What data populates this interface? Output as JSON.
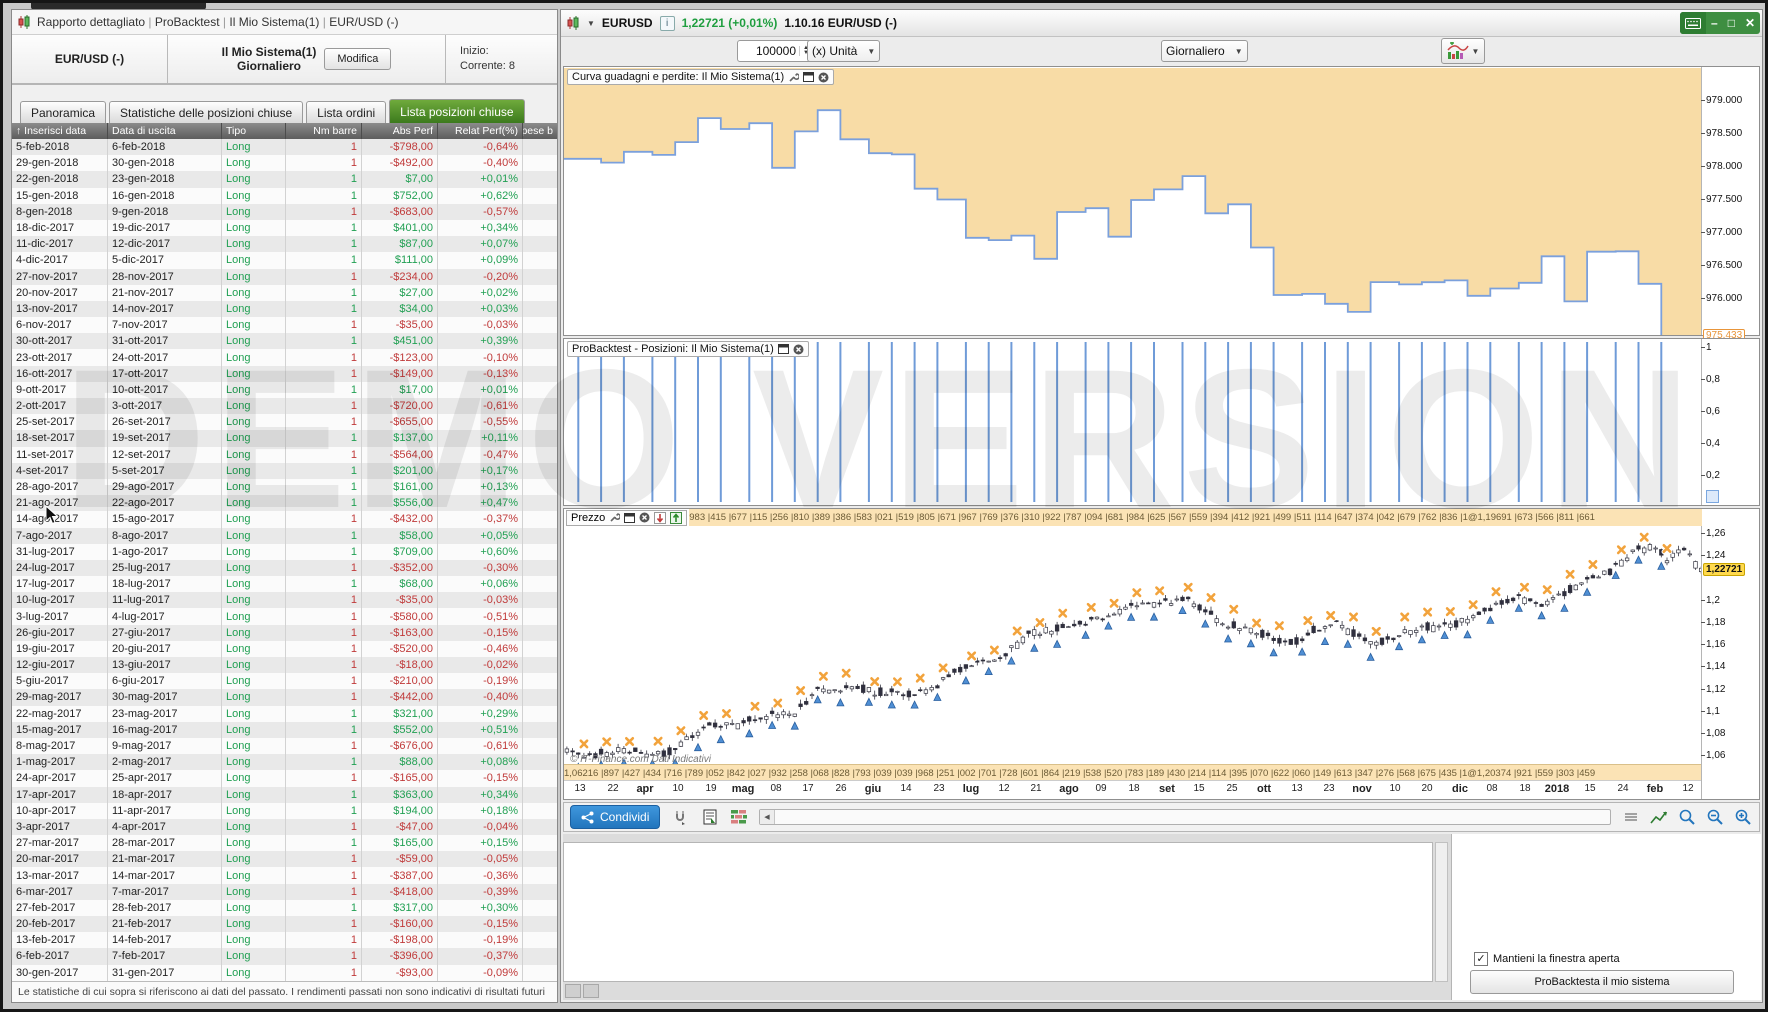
{
  "watermark": "DEMO VERSION",
  "report_window": {
    "breadcrumb": [
      "Rapporto dettagliato",
      "ProBacktest",
      "Il Mio Sistema(1)",
      "EUR/USD (-)"
    ],
    "header": {
      "instrument": "EUR/USD (-)",
      "system": "Il Mio Sistema(1)",
      "timeframe": "Giornaliero",
      "modify": "Modifica",
      "start_label": "Inizio:",
      "current_label": "Corrente: 8"
    },
    "tabs": [
      {
        "label": "Panoramica",
        "active": false
      },
      {
        "label": "Statistiche delle posizioni chiuse",
        "active": false
      },
      {
        "label": "Lista ordini",
        "active": false
      },
      {
        "label": "Lista posizioni chiuse",
        "active": true
      }
    ],
    "table": {
      "sort_icon": "↑",
      "columns": [
        "Inserisci data",
        "Data di uscita",
        "Tipo",
        "Nm barre",
        "Abs Perf",
        "Relat Perf(%)",
        "Spese b"
      ],
      "rows": [
        [
          "5-feb-2018",
          "6-feb-2018",
          "Long",
          "1",
          "-$798,00",
          "-0,64%"
        ],
        [
          "29-gen-2018",
          "30-gen-2018",
          "Long",
          "1",
          "-$492,00",
          "-0,40%"
        ],
        [
          "22-gen-2018",
          "23-gen-2018",
          "Long",
          "1",
          "$7,00",
          "+0,01%"
        ],
        [
          "15-gen-2018",
          "16-gen-2018",
          "Long",
          "1",
          "$752,00",
          "+0,62%"
        ],
        [
          "8-gen-2018",
          "9-gen-2018",
          "Long",
          "1",
          "-$683,00",
          "-0,57%"
        ],
        [
          "18-dic-2017",
          "19-dic-2017",
          "Long",
          "1",
          "$401,00",
          "+0,34%"
        ],
        [
          "11-dic-2017",
          "12-dic-2017",
          "Long",
          "1",
          "$87,00",
          "+0,07%"
        ],
        [
          "4-dic-2017",
          "5-dic-2017",
          "Long",
          "1",
          "$111,00",
          "+0,09%"
        ],
        [
          "27-nov-2017",
          "28-nov-2017",
          "Long",
          "1",
          "-$234,00",
          "-0,20%"
        ],
        [
          "20-nov-2017",
          "21-nov-2017",
          "Long",
          "1",
          "$27,00",
          "+0,02%"
        ],
        [
          "13-nov-2017",
          "14-nov-2017",
          "Long",
          "1",
          "$34,00",
          "+0,03%"
        ],
        [
          "6-nov-2017",
          "7-nov-2017",
          "Long",
          "1",
          "-$35,00",
          "-0,03%"
        ],
        [
          "30-ott-2017",
          "31-ott-2017",
          "Long",
          "1",
          "$451,00",
          "+0,39%"
        ],
        [
          "23-ott-2017",
          "24-ott-2017",
          "Long",
          "1",
          "-$123,00",
          "-0,10%"
        ],
        [
          "16-ott-2017",
          "17-ott-2017",
          "Long",
          "1",
          "-$149,00",
          "-0,13%"
        ],
        [
          "9-ott-2017",
          "10-ott-2017",
          "Long",
          "1",
          "$17,00",
          "+0,01%"
        ],
        [
          "2-ott-2017",
          "3-ott-2017",
          "Long",
          "1",
          "-$720,00",
          "-0,61%"
        ],
        [
          "25-set-2017",
          "26-set-2017",
          "Long",
          "1",
          "-$655,00",
          "-0,55%"
        ],
        [
          "18-set-2017",
          "19-set-2017",
          "Long",
          "1",
          "$137,00",
          "+0,11%"
        ],
        [
          "11-set-2017",
          "12-set-2017",
          "Long",
          "1",
          "-$564,00",
          "-0,47%"
        ],
        [
          "4-set-2017",
          "5-set-2017",
          "Long",
          "1",
          "$201,00",
          "+0,17%"
        ],
        [
          "28-ago-2017",
          "29-ago-2017",
          "Long",
          "1",
          "$161,00",
          "+0,13%"
        ],
        [
          "21-ago-2017",
          "22-ago-2017",
          "Long",
          "1",
          "$556,00",
          "+0,47%"
        ],
        [
          "14-ago-2017",
          "15-ago-2017",
          "Long",
          "1",
          "-$432,00",
          "-0,37%"
        ],
        [
          "7-ago-2017",
          "8-ago-2017",
          "Long",
          "1",
          "$58,00",
          "+0,05%"
        ],
        [
          "31-lug-2017",
          "1-ago-2017",
          "Long",
          "1",
          "$709,00",
          "+0,60%"
        ],
        [
          "24-lug-2017",
          "25-lug-2017",
          "Long",
          "1",
          "-$352,00",
          "-0,30%"
        ],
        [
          "17-lug-2017",
          "18-lug-2017",
          "Long",
          "1",
          "$68,00",
          "+0,06%"
        ],
        [
          "10-lug-2017",
          "11-lug-2017",
          "Long",
          "1",
          "-$35,00",
          "-0,03%"
        ],
        [
          "3-lug-2017",
          "4-lug-2017",
          "Long",
          "1",
          "-$580,00",
          "-0,51%"
        ],
        [
          "26-giu-2017",
          "27-giu-2017",
          "Long",
          "1",
          "-$163,00",
          "-0,15%"
        ],
        [
          "19-giu-2017",
          "20-giu-2017",
          "Long",
          "1",
          "-$520,00",
          "-0,46%"
        ],
        [
          "12-giu-2017",
          "13-giu-2017",
          "Long",
          "1",
          "-$18,00",
          "-0,02%"
        ],
        [
          "5-giu-2017",
          "6-giu-2017",
          "Long",
          "1",
          "-$210,00",
          "-0,19%"
        ],
        [
          "29-mag-2017",
          "30-mag-2017",
          "Long",
          "1",
          "-$442,00",
          "-0,40%"
        ],
        [
          "22-mag-2017",
          "23-mag-2017",
          "Long",
          "1",
          "$321,00",
          "+0,29%"
        ],
        [
          "15-mag-2017",
          "16-mag-2017",
          "Long",
          "1",
          "$552,00",
          "+0,51%"
        ],
        [
          "8-mag-2017",
          "9-mag-2017",
          "Long",
          "1",
          "-$676,00",
          "-0,61%"
        ],
        [
          "1-mag-2017",
          "2-mag-2017",
          "Long",
          "1",
          "$88,00",
          "+0,08%"
        ],
        [
          "24-apr-2017",
          "25-apr-2017",
          "Long",
          "1",
          "-$165,00",
          "-0,15%"
        ],
        [
          "17-apr-2017",
          "18-apr-2017",
          "Long",
          "1",
          "$363,00",
          "+0,34%"
        ],
        [
          "10-apr-2017",
          "11-apr-2017",
          "Long",
          "1",
          "$194,00",
          "+0,18%"
        ],
        [
          "3-apr-2017",
          "4-apr-2017",
          "Long",
          "1",
          "-$47,00",
          "-0,04%"
        ],
        [
          "27-mar-2017",
          "28-mar-2017",
          "Long",
          "1",
          "$165,00",
          "+0,15%"
        ],
        [
          "20-mar-2017",
          "21-mar-2017",
          "Long",
          "1",
          "-$59,00",
          "-0,05%"
        ],
        [
          "13-mar-2017",
          "14-mar-2017",
          "Long",
          "1",
          "-$387,00",
          "-0,36%"
        ],
        [
          "6-mar-2017",
          "7-mar-2017",
          "Long",
          "1",
          "-$418,00",
          "-0,39%"
        ],
        [
          "27-feb-2017",
          "28-feb-2017",
          "Long",
          "1",
          "$317,00",
          "+0,30%"
        ],
        [
          "20-feb-2017",
          "21-feb-2017",
          "Long",
          "1",
          "-$160,00",
          "-0,15%"
        ],
        [
          "13-feb-2017",
          "14-feb-2017",
          "Long",
          "1",
          "-$198,00",
          "-0,19%"
        ],
        [
          "6-feb-2017",
          "7-feb-2017",
          "Long",
          "1",
          "-$396,00",
          "-0,37%"
        ],
        [
          "30-gen-2017",
          "31-gen-2017",
          "Long",
          "1",
          "-$93,00",
          "-0,09%"
        ]
      ]
    },
    "footer": "Le statistiche di cui sopra si riferiscono ai dati del passato. I rendimenti passati non sono indicativi di risultati futuri"
  },
  "chart_window": {
    "titlebar": {
      "symbol": "EURUSD",
      "info": "i",
      "quote": "1,22721 (+0,01%)",
      "session": "1.10.16 EUR/USD (-)"
    },
    "toolbar": {
      "quantity": "100000",
      "unit": "(x) Unità",
      "timeframe": "Giornaliero"
    },
    "equity_panel": {
      "title": "Curva guadagni e perdite: Il Mio Sistema(1)",
      "axis_labels": [
        "979.000",
        "978.500",
        "978.000",
        "977.500",
        "977.000",
        "976.500",
        "976.000"
      ],
      "axis_values": [
        979.0,
        978.5,
        978.0,
        977.5,
        977.0,
        976.5,
        976.0
      ],
      "current_label": "975.433",
      "current_value": 975.433,
      "series": [
        978.125,
        978.066,
        978.231,
        978.184,
        978.378,
        978.741,
        978.576,
        978.664,
        977.988,
        978.54,
        978.861,
        978.419,
        978.209,
        978.191,
        977.671,
        977.508,
        976.928,
        976.893,
        976.961,
        976.609,
        977.318,
        977.376,
        976.944,
        977.5,
        977.661,
        977.862,
        977.298,
        977.435,
        976.78,
        976.06,
        976.077,
        975.928,
        975.805,
        976.256,
        976.221,
        976.255,
        976.282,
        976.048,
        976.159,
        976.246,
        976.647,
        975.964,
        976.716,
        976.723,
        976.231,
        975.433
      ]
    },
    "positions_panel": {
      "title": "ProBacktest - Posizioni: Il Mio Sistema(1)",
      "axis_labels": [
        "1",
        "0,8",
        "0,6",
        "0,4",
        "0,2"
      ],
      "axis_values": [
        1.0,
        0.8,
        0.6,
        0.4,
        0.2
      ],
      "count": 46
    },
    "price_panel": {
      "title": "Prezzo",
      "top_strip": "983 |415 |677 |115 |256 |810 |389 |386 |583 |021 |519 |805 |671 |967 |769 |376 |310 |922 |787 |094 |681 |984 |625 |567 |559 |394 |412 |921 |499 |511 |114 |647 |374 |042 |679 |762 |836 |1@1,19691 |673 |566 |811 |661",
      "bottom_strip": "1,06216 |897 |427 |434 |716 |789 |052 |842 |027 |932 |258 |068 |828 |793 |039 |039 |968 |251 |002 |701 |728 |601 |864 |219 |538 |520 |783 |189 |430 |214 |114 |395 |070 |622 |060 |149 |613 |347 |276 |568 |675 |435 |1@1,20374 |921 |559 |303 |459",
      "provider_note": "© IT-Finance.com Dati Indicativi",
      "axis_labels": [
        "1,26",
        "1,24",
        "1,2",
        "1,18",
        "1,16",
        "1,14",
        "1,12",
        "1,1",
        "1,08",
        "1,06"
      ],
      "axis_values": [
        1.26,
        1.24,
        1.2,
        1.18,
        1.16,
        1.14,
        1.12,
        1.1,
        1.08,
        1.06
      ],
      "current_label": "1,22721",
      "current_value": 1.22721,
      "x_labels": [
        "13",
        "22",
        "apr",
        "10",
        "19",
        "mag",
        "08",
        "17",
        "26",
        "giu",
        "14",
        "23",
        "lug",
        "12",
        "21",
        "ago",
        "09",
        "18",
        "set",
        "15",
        "25",
        "ott",
        "13",
        "23",
        "nov",
        "10",
        "20",
        "dic",
        "08",
        "18",
        "2018",
        "15",
        "24",
        "feb",
        "12"
      ],
      "bold_x_labels": [
        "apr",
        "mag",
        "giu",
        "lug",
        "ago",
        "set",
        "ott",
        "nov",
        "dic",
        "2018",
        "feb"
      ],
      "price_path": [
        [
          0.0,
          1.064
        ],
        [
          0.02,
          1.06
        ],
        [
          0.05,
          1.066
        ],
        [
          0.07,
          1.062
        ],
        [
          0.09,
          1.063
        ],
        [
          0.1,
          1.072
        ],
        [
          0.125,
          1.089
        ],
        [
          0.15,
          1.087
        ],
        [
          0.17,
          1.096
        ],
        [
          0.2,
          1.098
        ],
        [
          0.22,
          1.118
        ],
        [
          0.25,
          1.123
        ],
        [
          0.27,
          1.118
        ],
        [
          0.3,
          1.115
        ],
        [
          0.32,
          1.12
        ],
        [
          0.35,
          1.14
        ],
        [
          0.38,
          1.147
        ],
        [
          0.41,
          1.172
        ],
        [
          0.44,
          1.175
        ],
        [
          0.46,
          1.181
        ],
        [
          0.49,
          1.192
        ],
        [
          0.52,
          1.197
        ],
        [
          0.545,
          1.203
        ],
        [
          0.56,
          1.192
        ],
        [
          0.58,
          1.178
        ],
        [
          0.6,
          1.176
        ],
        [
          0.62,
          1.166
        ],
        [
          0.64,
          1.161
        ],
        [
          0.66,
          1.175
        ],
        [
          0.68,
          1.179
        ],
        [
          0.7,
          1.165
        ],
        [
          0.72,
          1.162
        ],
        [
          0.74,
          1.173
        ],
        [
          0.76,
          1.176
        ],
        [
          0.78,
          1.177
        ],
        [
          0.8,
          1.187
        ],
        [
          0.82,
          1.196
        ],
        [
          0.84,
          1.202
        ],
        [
          0.86,
          1.195
        ],
        [
          0.88,
          1.207
        ],
        [
          0.9,
          1.22
        ],
        [
          0.92,
          1.226
        ],
        [
          0.94,
          1.243
        ],
        [
          0.955,
          1.25
        ],
        [
          0.97,
          1.238
        ],
        [
          0.985,
          1.246
        ],
        [
          1.0,
          1.227
        ]
      ]
    },
    "bottombar": {
      "share": "Condividi"
    },
    "bottom_panel": {
      "keep_open": "Mantieni la finestra aperta",
      "backtest": "ProBacktesta il mio sistema"
    }
  }
}
